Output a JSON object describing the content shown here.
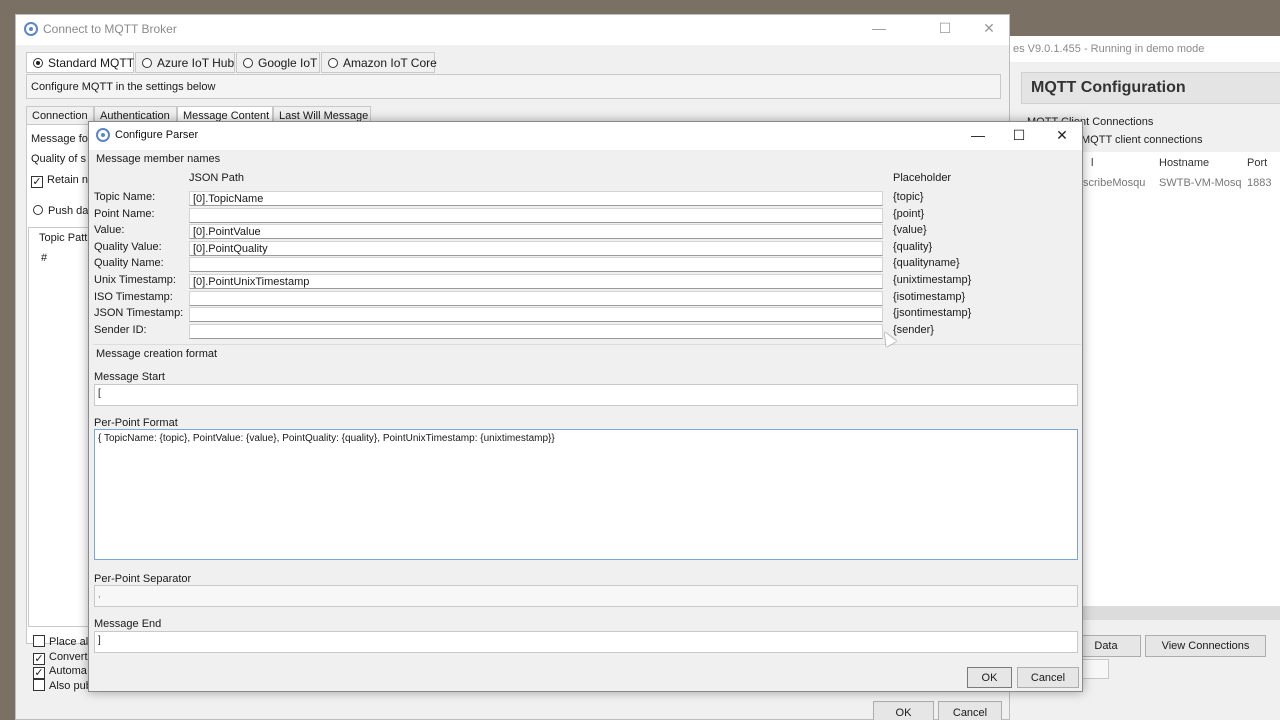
{
  "bg_app": {
    "title": "es V9.0.1.455 - Running in demo mode",
    "panel_title": "MQTT Configuration",
    "line1": "MQTT Client Connections",
    "line2": "MQTT client connections",
    "columns": [
      "l",
      "Hostname",
      "Port"
    ],
    "row": [
      "scribeMosqu",
      "SWTB-VM-Mosq",
      "1883"
    ],
    "btn_data": "Data",
    "btn_view": "View Connections"
  },
  "broker": {
    "title": "Connect to MQTT Broker",
    "radios": [
      "Standard MQTT",
      "Azure IoT Hub",
      "Google IoT",
      "Amazon IoT Core"
    ],
    "selected_radio": "Standard MQTT",
    "hint": "Configure MQTT in the settings below",
    "tabs": [
      "Connection",
      "Authentication",
      "Message Content",
      "Last Will Message"
    ],
    "active_tab": "Message Content",
    "frag_message_fo": "Message fo",
    "frag_quality": "Quality of s",
    "frag_retain": "Retain n",
    "frag_push": "Push da",
    "frag_topic_patt": "Topic Patt",
    "frag_hash": "#",
    "frag_place_all": "Place all",
    "frag_convert": "Convert",
    "frag_automa": "Automa",
    "frag_also_pub": "Also pub",
    "ok": "OK",
    "cancel": "Cancel"
  },
  "parser": {
    "title": "Configure Parser",
    "section_members": "Message member names",
    "col_json_path": "JSON Path",
    "col_placeholder": "Placeholder",
    "members": [
      {
        "label": "Topic Name:",
        "value": "[0].TopicName",
        "placeholder": "{topic}"
      },
      {
        "label": "Point Name:",
        "value": "",
        "placeholder": "{point}"
      },
      {
        "label": "Value:",
        "value": "[0].PointValue",
        "placeholder": "{value}"
      },
      {
        "label": "Quality Value:",
        "value": "[0].PointQuality",
        "placeholder": "{quality}"
      },
      {
        "label": "Quality Name:",
        "value": "",
        "placeholder": "{qualityname}"
      },
      {
        "label": "Unix Timestamp:",
        "value": "[0].PointUnixTimestamp",
        "placeholder": "{unixtimestamp}"
      },
      {
        "label": "ISO Timestamp:",
        "value": "",
        "placeholder": "{isotimestamp}"
      },
      {
        "label": "JSON Timestamp:",
        "value": "",
        "placeholder": "{jsontimestamp}"
      },
      {
        "label": "Sender ID:",
        "value": "",
        "placeholder": "{sender}"
      }
    ],
    "section_creation": "Message creation format",
    "message_start_label": "Message Start",
    "message_start_value": "[",
    "per_point_format_label": "Per-Point Format",
    "per_point_format_value": "{ TopicName: {topic}, PointValue: {value}, PointQuality: {quality}, PointUnixTimestamp: {unixtimestamp}}",
    "per_point_separator_label": "Per-Point Separator",
    "per_point_separator_value": ",",
    "message_end_label": "Message End",
    "message_end_value": "]",
    "ok": "OK",
    "cancel": "Cancel"
  },
  "icons": {
    "window_icon": "gear-icon",
    "minimize": "minimize-icon",
    "maximize": "maximize-icon",
    "close": "close-icon"
  }
}
